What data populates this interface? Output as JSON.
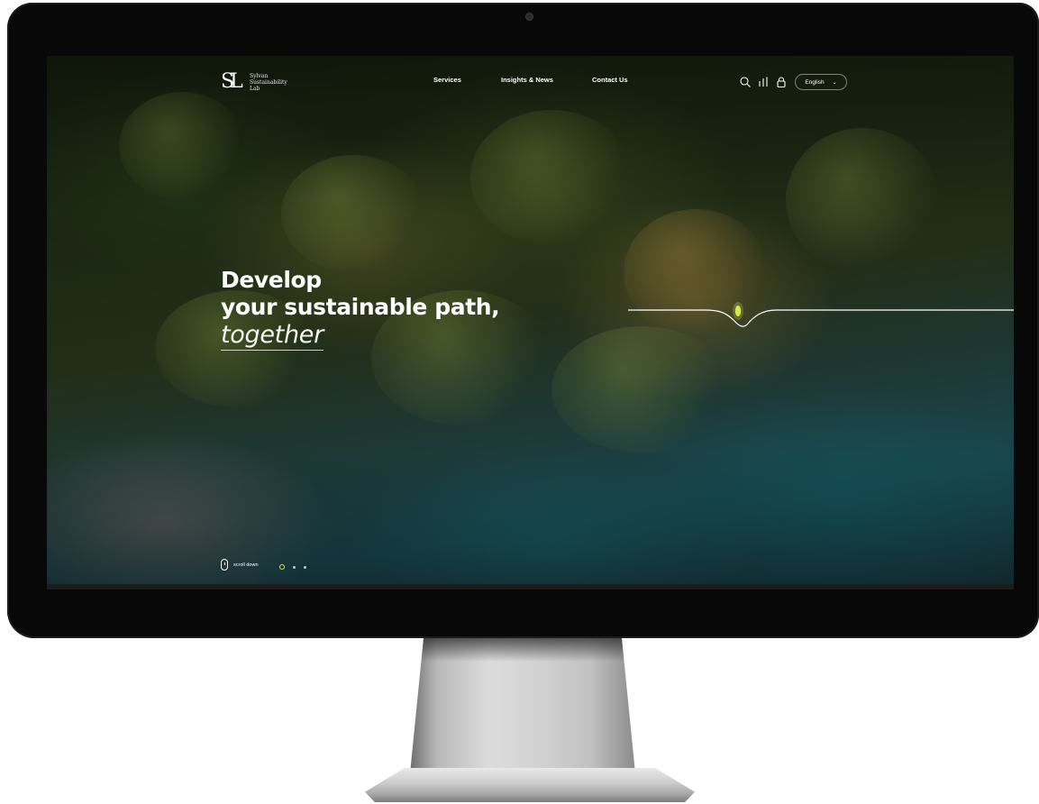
{
  "logo": {
    "mark": "SL",
    "lines": [
      "Sylvan",
      "Sustainability",
      "Lab"
    ]
  },
  "nav": {
    "links": [
      "Services",
      "Insights & News",
      "Contact Us"
    ]
  },
  "tools": {
    "icons": [
      "search-icon",
      "bars-icon",
      "lock-icon"
    ],
    "language": "English"
  },
  "hero": {
    "line1": "Develop",
    "line2": "your sustainable path,",
    "line3": "together"
  },
  "footer": {
    "scroll_label": "scroll down",
    "slides": 3,
    "active_slide": 1
  },
  "colors": {
    "accent": "#d6e84a",
    "text": "#ffffff"
  }
}
